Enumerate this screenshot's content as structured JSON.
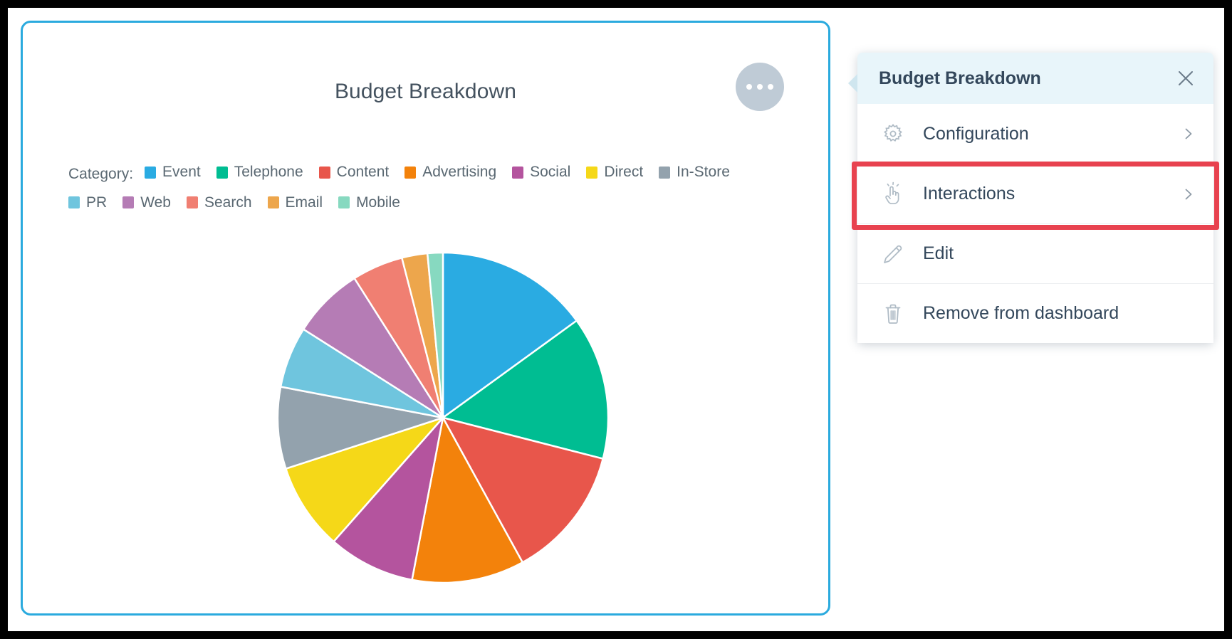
{
  "colors": {
    "card_border": "#2aaade",
    "panel_header_bg": "#e8f5fa",
    "highlight": "#e8424f",
    "text": "#33475b",
    "legend_text": "#5a6872",
    "kebab_bg": "#bfcbd6"
  },
  "card": {
    "title": "Budget Breakdown",
    "kebab_name": "more-options"
  },
  "legend": {
    "label": "Category:"
  },
  "panel": {
    "title": "Budget Breakdown",
    "close_icon": "close-icon",
    "items": [
      {
        "label": "Configuration",
        "icon": "gear-icon",
        "chevron": "chevron-right-icon",
        "highlighted": false
      },
      {
        "label": "Interactions",
        "icon": "click-hand-icon",
        "chevron": "chevron-right-icon",
        "highlighted": true
      },
      {
        "label": "Edit",
        "icon": "pencil-icon",
        "chevron": "",
        "highlighted": false
      },
      {
        "label": "Remove from dashboard",
        "icon": "trash-icon",
        "chevron": "",
        "highlighted": false
      }
    ]
  },
  "chart_data": {
    "type": "pie",
    "title": "Budget Breakdown",
    "legend_title": "Category:",
    "legend_position": "top-left",
    "grid": false,
    "start_angle_deg": 0,
    "direction": "clockwise",
    "labels": [
      "Event",
      "Telephone",
      "Content",
      "Advertising",
      "Social",
      "Direct",
      "In-Store",
      "PR",
      "Web",
      "Search",
      "Email",
      "Mobile"
    ],
    "colors": [
      "#2aabe2",
      "#00bd92",
      "#e8564b",
      "#f3820b",
      "#b martian",
      "#f5d818",
      "#93a2ad",
      "#6fc5de",
      "#b57cb5",
      "#f07f72",
      "#eda64c",
      "#87d9c0"
    ],
    "slice_colors": [
      "#2aabe2",
      "#00bd92",
      "#e8564b",
      "#f3820b",
      "#b4549e",
      "#f5d818",
      "#93a2ad",
      "#6fc5de",
      "#b57cb5",
      "#f07f72",
      "#eda64c",
      "#87d9c0"
    ],
    "values": [
      15.0,
      14.0,
      13.0,
      11.0,
      8.5,
      8.5,
      8.0,
      6.0,
      7.0,
      5.0,
      2.5,
      1.5
    ],
    "unit": "percent",
    "total": 100
  }
}
